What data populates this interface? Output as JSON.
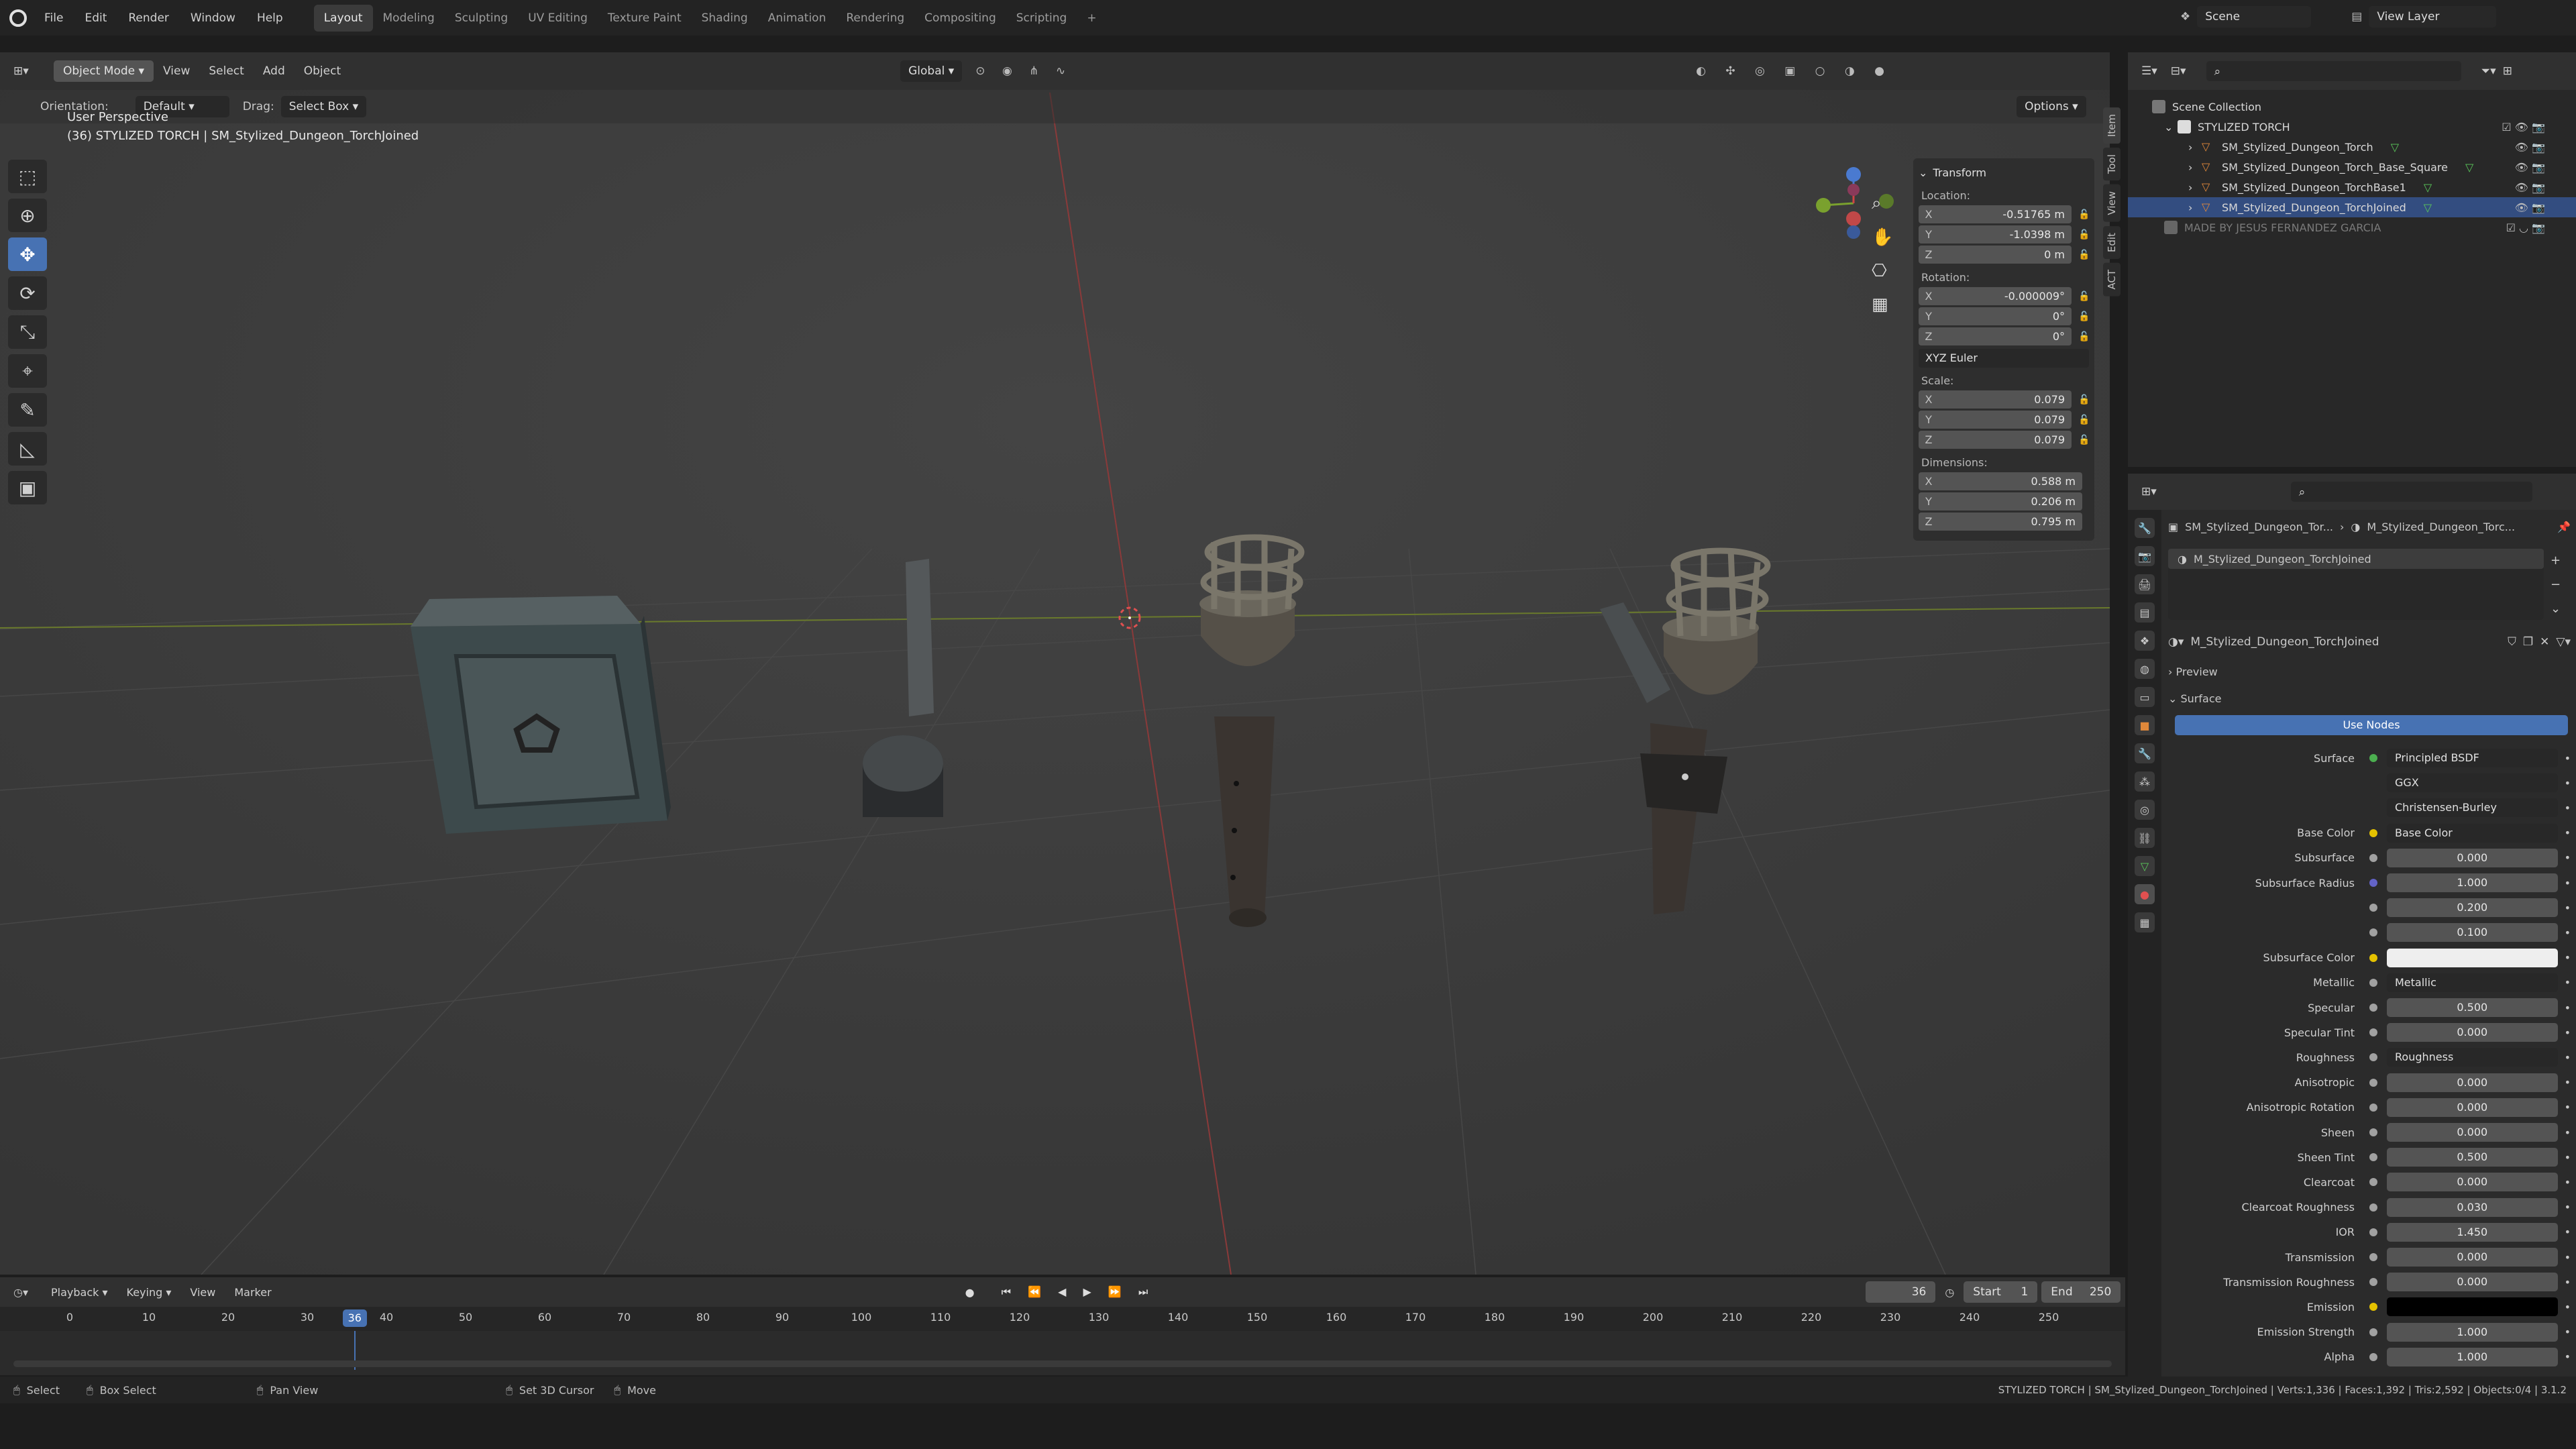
{
  "topbar": {
    "menus": [
      "File",
      "Edit",
      "Render",
      "Window",
      "Help"
    ],
    "workspaces": [
      "Layout",
      "Modeling",
      "Sculpting",
      "UV Editing",
      "Texture Paint",
      "Shading",
      "Animation",
      "Rendering",
      "Compositing",
      "Scripting"
    ],
    "active_workspace": "Layout",
    "plus": "+",
    "scene_label": "Scene",
    "view_layer_label": "View Layer"
  },
  "viewport": {
    "mode": "Object Mode",
    "menus": [
      "View",
      "Select",
      "Add",
      "Object"
    ],
    "transform_orientation": "Global",
    "orientation_label": "Orientation:",
    "orientation_value": "Default",
    "drag_label": "Drag:",
    "drag_value": "Select Box",
    "options_label": "Options",
    "perspective": "User Perspective",
    "object_info": "(36) STYLIZED TORCH | SM_Stylized_Dungeon_TorchJoined"
  },
  "npanel": {
    "title": "Transform",
    "location_label": "Location:",
    "location": {
      "x": "-0.51765 m",
      "y": "-1.0398 m",
      "z": "0 m"
    },
    "rotation_label": "Rotation:",
    "rotation": {
      "x": "-0.000009°",
      "y": "0°",
      "z": "0°"
    },
    "rotation_mode": "XYZ Euler",
    "scale_label": "Scale:",
    "scale": {
      "x": "0.079",
      "y": "0.079",
      "z": "0.079"
    },
    "dimensions_label": "Dimensions:",
    "dimensions": {
      "x": "0.588 m",
      "y": "0.206 m",
      "z": "0.795 m"
    },
    "axes": [
      "X",
      "Y",
      "Z"
    ],
    "tabs": [
      "Item",
      "Tool",
      "View",
      "Edit",
      "ACT"
    ]
  },
  "outliner": {
    "root": "Scene Collection",
    "collection": "STYLIZED TORCH",
    "items": [
      "SM_Stylized_Dungeon_Torch",
      "SM_Stylized_Dungeon_Torch_Base_Square",
      "SM_Stylized_Dungeon_TorchBase1",
      "SM_Stylized_Dungeon_TorchJoined"
    ],
    "extra": "MADE BY JESUS FERNANDEZ GARCIA"
  },
  "properties": {
    "breadcrumb_obj": "SM_Stylized_Dungeon_Tor...",
    "breadcrumb_mat": "M_Stylized_Dungeon_Torc...",
    "slot": "M_Stylized_Dungeon_TorchJoined",
    "material": "M_Stylized_Dungeon_TorchJoined",
    "preview": "Preview",
    "surface_section": "Surface",
    "use_nodes": "Use Nodes",
    "rows": [
      {
        "label": "Surface",
        "kind": "link",
        "value": "Principled BSDF",
        "dot": "#4caf50"
      },
      {
        "label": "",
        "kind": "select",
        "value": "GGX"
      },
      {
        "label": "",
        "kind": "select",
        "value": "Christensen-Burley"
      },
      {
        "label": "Base Color",
        "kind": "link",
        "value": "Base Color",
        "dot": "#e5c200"
      },
      {
        "label": "Subsurface",
        "kind": "num",
        "value": "0.000",
        "fill": 0
      },
      {
        "label": "Subsurface Radius",
        "kind": "num",
        "value": "1.000",
        "fill": 0,
        "dot": "#6363c7"
      },
      {
        "label": "",
        "kind": "num",
        "value": "0.200",
        "fill": 0
      },
      {
        "label": "",
        "kind": "num",
        "value": "0.100",
        "fill": 0
      },
      {
        "label": "Subsurface Color",
        "kind": "color",
        "value": "",
        "color": "#eeeeee",
        "dot": "#e5c200"
      },
      {
        "label": "Metallic",
        "kind": "link",
        "value": "Metallic"
      },
      {
        "label": "Specular",
        "kind": "num",
        "value": "0.500",
        "fill": 0.5
      },
      {
        "label": "Specular Tint",
        "kind": "num",
        "value": "0.000",
        "fill": 0
      },
      {
        "label": "Roughness",
        "kind": "link",
        "value": "Roughness"
      },
      {
        "label": "Anisotropic",
        "kind": "num",
        "value": "0.000",
        "fill": 0
      },
      {
        "label": "Anisotropic Rotation",
        "kind": "num",
        "value": "0.000",
        "fill": 0
      },
      {
        "label": "Sheen",
        "kind": "num",
        "value": "0.000",
        "fill": 0
      },
      {
        "label": "Sheen Tint",
        "kind": "num",
        "value": "0.500",
        "fill": 0.5
      },
      {
        "label": "Clearcoat",
        "kind": "num",
        "value": "0.000",
        "fill": 0
      },
      {
        "label": "Clearcoat Roughness",
        "kind": "num",
        "value": "0.030",
        "fill": 0.03
      },
      {
        "label": "IOR",
        "kind": "num",
        "value": "1.450",
        "fill": 0
      },
      {
        "label": "Transmission",
        "kind": "num",
        "value": "0.000",
        "fill": 0
      },
      {
        "label": "Transmission Roughness",
        "kind": "num",
        "value": "0.000",
        "fill": 0
      },
      {
        "label": "Emission",
        "kind": "color",
        "value": "",
        "color": "#000000",
        "dot": "#e5c200"
      },
      {
        "label": "Emission Strength",
        "kind": "num",
        "value": "1.000",
        "fill": 0
      },
      {
        "label": "Alpha",
        "kind": "num",
        "value": "1.000",
        "fill": 1
      }
    ]
  },
  "timeline": {
    "menus": [
      "Playback",
      "Keying",
      "View",
      "Marker"
    ],
    "current_frame": "36",
    "start_label": "Start",
    "start": "1",
    "end_label": "End",
    "end": "250",
    "ticks": [
      "0",
      "10",
      "20",
      "30",
      "40",
      "50",
      "60",
      "70",
      "80",
      "90",
      "100",
      "110",
      "120",
      "130",
      "140",
      "150",
      "160",
      "170",
      "180",
      "190",
      "200",
      "210",
      "220",
      "230",
      "240",
      "250"
    ]
  },
  "status": {
    "select": "Select",
    "box_select": "Box Select",
    "pan_view": "Pan View",
    "set_cursor": "Set 3D Cursor",
    "move": "Move",
    "stats": "STYLIZED TORCH | SM_Stylized_Dungeon_TorchJoined | Verts:1,336 | Faces:1,392 | Tris:2,592 | Objects:0/4 | 3.1.2"
  }
}
